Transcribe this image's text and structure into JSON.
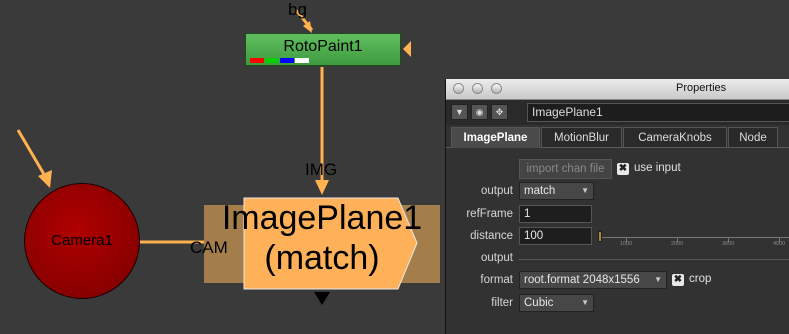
{
  "graph": {
    "labels": {
      "bg": "bg",
      "img": "IMG",
      "cam": "CAM"
    },
    "roto_node": {
      "title": "RotoPaint1",
      "channel_colors": [
        "#ff0000",
        "#00d000",
        "#0000ff",
        "#ffffff"
      ]
    },
    "camera_node": {
      "title": "Camera1",
      "color": "#9a0000"
    },
    "imageplane_node": {
      "line1": "ImagePlane1",
      "line2": "(match)",
      "color": "#ffb15a"
    },
    "pipe_color": "#ffb24d"
  },
  "panel": {
    "window_title": "Properties",
    "node_name": "ImagePlane1",
    "header_icons": [
      "collapse-triangle-icon",
      "node-view-icon",
      "pin-icon"
    ],
    "tabs": [
      {
        "label": "ImagePlane",
        "active": true
      },
      {
        "label": "MotionBlur",
        "active": false
      },
      {
        "label": "CameraKnobs",
        "active": false
      },
      {
        "label": "Node",
        "active": false
      }
    ],
    "import_button": "import chan file",
    "use_input": {
      "label": "use input",
      "checked": true
    },
    "output": {
      "label": "output",
      "value": "match"
    },
    "refFrame": {
      "label": "refFrame",
      "value": "1"
    },
    "distance": {
      "label": "distance",
      "value": "100",
      "slider_ticks": [
        "1000",
        "2000",
        "3000",
        "4000",
        "5000"
      ]
    },
    "output_section": {
      "label": "output"
    },
    "format": {
      "label": "format",
      "value": "root.format 2048x1556"
    },
    "crop": {
      "label": "crop",
      "checked": true
    },
    "filter": {
      "label": "filter",
      "value": "Cubic"
    }
  }
}
